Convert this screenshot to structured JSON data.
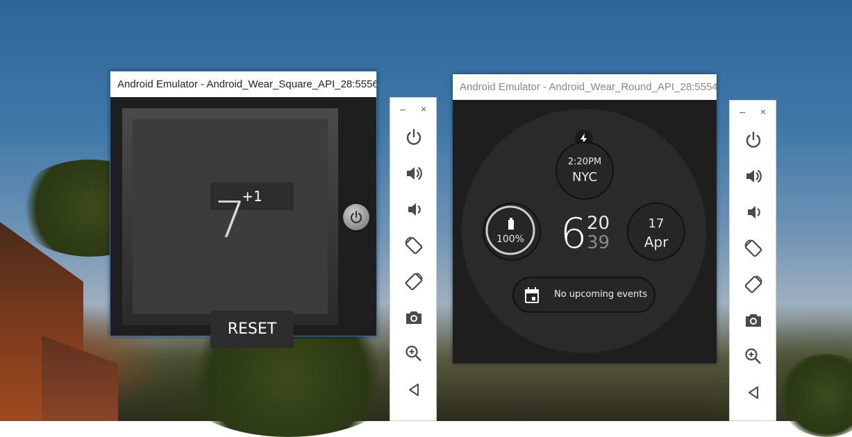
{
  "square_emulator": {
    "title": "Android Emulator - Android_Wear_Square_API_28:5556",
    "increment_label": "+1",
    "counter_value": "7",
    "reset_label": "RESET"
  },
  "round_emulator": {
    "title": "Android Emulator - Android_Wear_Round_API_28:5554",
    "world_clock_time": "2:20PM",
    "world_clock_city": "NYC",
    "battery_percent": "100%",
    "battery_level": 1.0,
    "time_hour": "6",
    "time_minute": "20",
    "time_second": "39",
    "date_day": "17",
    "date_month": "Apr",
    "events_text": "No upcoming events"
  },
  "toolbar": {
    "minimize_glyph": "–",
    "close_glyph": "×",
    "buttons": [
      {
        "icon": "power-icon"
      },
      {
        "icon": "volume-up-icon"
      },
      {
        "icon": "volume-down-icon"
      },
      {
        "icon": "rotate-left-icon"
      },
      {
        "icon": "rotate-right-icon"
      },
      {
        "icon": "camera-icon"
      },
      {
        "icon": "zoom-icon"
      },
      {
        "icon": "back-icon"
      }
    ]
  },
  "colors": {
    "window_bg": "#1e1e1e",
    "active_window_border": "#2b7bd6",
    "toolbar_icon": "#4a4a4a"
  }
}
